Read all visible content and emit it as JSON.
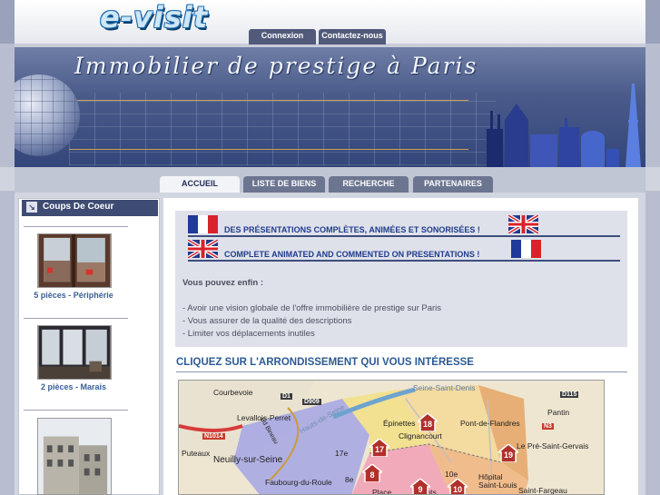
{
  "site": {
    "logo_text": "e-visit",
    "banner_title": "Immobilier de prestige à Paris"
  },
  "top_tabs": [
    {
      "label": "Connexion"
    },
    {
      "label": "Contactez-nous"
    }
  ],
  "nav_tabs": [
    {
      "label": "ACCUEIL",
      "active": true
    },
    {
      "label": "LISTE DE BIENS",
      "active": false
    },
    {
      "label": "RECHERCHE",
      "active": false
    },
    {
      "label": "PARTENAIRES",
      "active": false
    }
  ],
  "sidebar": {
    "title": "Coups De Coeur",
    "items": [
      {
        "caption": "5 pièces - Périphérie"
      },
      {
        "caption": "2 pièces - Marais"
      },
      {
        "caption": ""
      }
    ]
  },
  "intro": {
    "fr_line": "DES PRÉSENTATIONS COMPLÈTES, ANIMÉES ET SONORISÉES !",
    "en_line": "COMPLETE ANIMATED AND COMMENTED ON PRESENTATIONS !",
    "heading": "Vous pouvez enfin :",
    "bullets": [
      "- Avoir une vision globale de l'offre immobilière de prestige sur Paris",
      "- Vous assurer de la qualité des descriptions",
      "- Limiter vos déplacements inutiles"
    ]
  },
  "map_section": {
    "title": "CLIQUEZ SUR L'ARRONDISSEMENT QUI VOUS INTÉRESSE",
    "places": [
      "Courbevoie",
      "Levallois-Perret",
      "Épinettes",
      "Seine-Saint-Denis",
      "Pantin",
      "Pont-de-Flandres",
      "Le Pré-Saint-Gervais",
      "Clignancourt",
      "Neuilly-sur-Seine",
      "Puteaux",
      "Faubourg-du-Roule",
      "Hôpital Saint-Louis",
      "Saint-Fargeau",
      "Place",
      "Bd Bineau",
      "Hauts-de-Seine",
      "17e",
      "8e",
      "10e",
      "Ponts"
    ],
    "roads": [
      "D1",
      "D909",
      "D115",
      "N3",
      "N1014"
    ],
    "markers": [
      "18",
      "17",
      "19",
      "8",
      "9",
      "10"
    ]
  },
  "colors": {
    "nav_dark": "#525a7a",
    "accent_blue": "#2b5a94",
    "banner_blue": "#4a5b8a"
  }
}
